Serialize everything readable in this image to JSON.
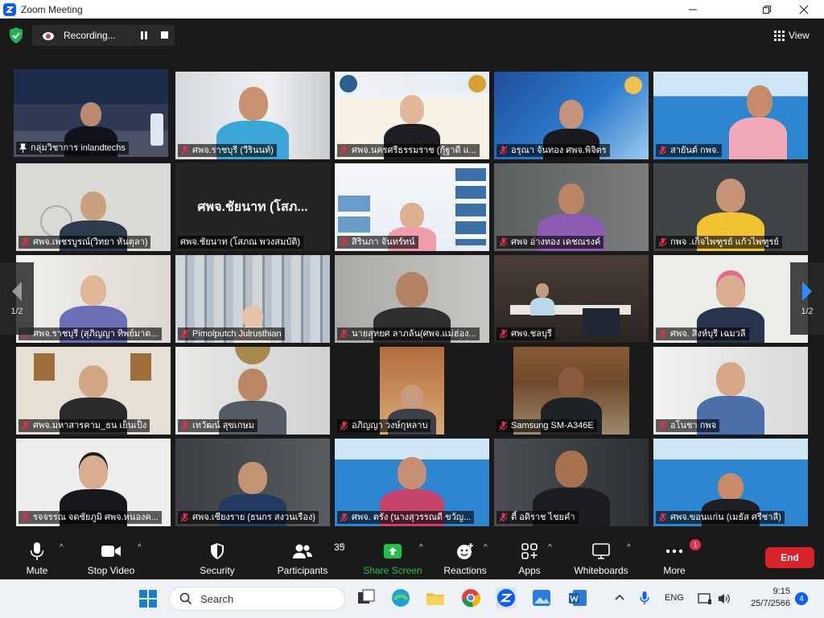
{
  "window": {
    "title": "Zoom Meeting"
  },
  "recording": {
    "label": "Recording..."
  },
  "view": {
    "label": "View"
  },
  "pager": {
    "left": "1/2",
    "right": "1/2"
  },
  "tiles": [
    {
      "name": "กลุ่มวิชาการ inlandtechs",
      "muted": false,
      "pinned": true
    },
    {
      "name": "ศพจ.ราชบุรี (วีรินนท์)",
      "muted": true
    },
    {
      "name": "ศพจ.นครศรีธรรมราช (กุ้ฐาดี แ...",
      "muted": true
    },
    {
      "name": "อรุณา จันทอง ศพจ.พิจิตร",
      "muted": true
    },
    {
      "name": "สายันต์ กพจ.",
      "muted": true
    },
    {
      "name": "ศพจ.เพชรบูรณ์(วิทยา หันตุลา)",
      "muted": true
    },
    {
      "name": "ศพจ.ชัยนาท (โสภณ พวงสมบัติ)",
      "muted": false,
      "big": "ศพจ.ชัยนาท (โสภ..."
    },
    {
      "name": "สิรินภา จันทร์ทน์",
      "muted": true
    },
    {
      "name": "ศพจ อ่างทอง เดชณรงค์",
      "muted": true
    },
    {
      "name": "กพจ .เก็จไพฑูรย์ แก้วไพฑูรย์",
      "muted": true
    },
    {
      "name": "ศพจ.ราชบุรี (สุภิญญา ทิพย์มาต...",
      "muted": true
    },
    {
      "name": "Pimolputch Julrusthian",
      "muted": true
    },
    {
      "name": "นายสุทยศ ลาภล้น(ศพจ.แม่ฮ่อง...",
      "muted": true
    },
    {
      "name": "ศพจ.ชลบุรี",
      "muted": true
    },
    {
      "name": "ศพจ. สิงห์บุรี เฉมวลี",
      "muted": true
    },
    {
      "name": "ศพจ.มหาสารคาม_ธน เย็นเป็ง",
      "muted": true
    },
    {
      "name": "เทวัฒน์ สุขเกษม",
      "muted": true
    },
    {
      "name": "อภิญญา วงษ์กุหลาบ",
      "muted": true
    },
    {
      "name": "Samsung SM-A346E",
      "muted": true
    },
    {
      "name": "อโนชา กพจ",
      "muted": true
    },
    {
      "name": "รจจรรณ จดชัยภูมิ ศพจ.หนองค...",
      "muted": true
    },
    {
      "name": "ศพจ.เชียงราย (ธนกร สงวนเรือง)",
      "muted": true
    },
    {
      "name": "ศพจ. ตรัง (นางสุวรรณดี ขวัญ...",
      "muted": true
    },
    {
      "name": "ตี้ อดิราช ไชยคำ",
      "muted": true
    },
    {
      "name": "ศพจ.ขอนแก่น (เมธัส ศรีชาลี)",
      "muted": true
    }
  ],
  "toolbar": {
    "mute": "Mute",
    "stop_video": "Stop Video",
    "security": "Security",
    "participants": "Participants",
    "participants_count": "35",
    "share": "Share Screen",
    "reactions": "Reactions",
    "apps": "Apps",
    "whiteboards": "Whiteboards",
    "more": "More",
    "more_badge": "1",
    "end": "End"
  },
  "taskbar": {
    "search": "Search",
    "lang": "ENG",
    "time": "9:15",
    "date": "25/7/2566",
    "notif": "4"
  },
  "colors": {
    "accent": "#0b5cff",
    "end": "#d9232a",
    "share": "#21c04a",
    "active_border": "#c5e83a",
    "muted": "#e0304a"
  }
}
